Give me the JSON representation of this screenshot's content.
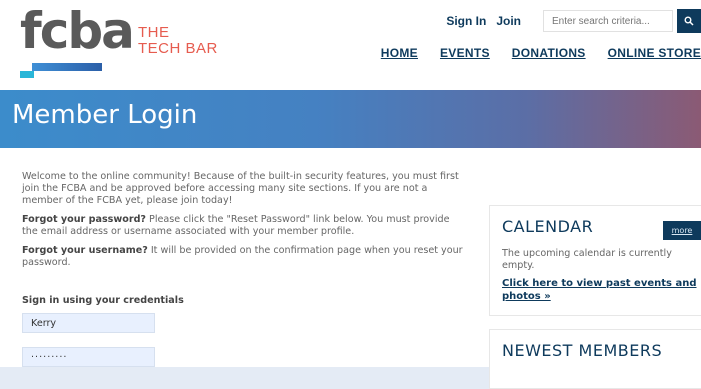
{
  "logo": {
    "word": "fcba",
    "line1": "THE",
    "line2": "TECH BAR"
  },
  "topbar": {
    "sign_in": "Sign In",
    "join": "Join",
    "search_placeholder": "Enter search criteria..."
  },
  "nav": {
    "items": [
      "HOME",
      "EVENTS",
      "DONATIONS",
      "ONLINE STORE"
    ]
  },
  "banner": {
    "title": "Member Login"
  },
  "intro": {
    "welcome": "Welcome to the online community! Because of the built-in security features, you must first join the FCBA and be approved before accessing many site sections. If you are not a member of the FCBA yet, please join today!",
    "forgot_password_bold": "Forgot your password?",
    "forgot_password_text": " Please click the \"Reset Password\" link below. You must provide the email address or username associated with your member profile.",
    "forgot_username_bold": "Forgot your username?",
    "forgot_username_text": " It will be provided on the confirmation page when you reset your password."
  },
  "form": {
    "label": "Sign in using your credentials",
    "username_value": "Kerry",
    "password_value": "·········"
  },
  "calendar": {
    "title": "CALENDAR",
    "more": "more",
    "empty_text": "The upcoming calendar is currently empty.",
    "past_link": "Click here to view past events and photos »"
  },
  "newest_members": {
    "title": "NEWEST MEMBERS"
  },
  "colors": {
    "navy": "#0e3a5c",
    "accent": "#e65c4f",
    "cyan": "#29b6d8"
  }
}
